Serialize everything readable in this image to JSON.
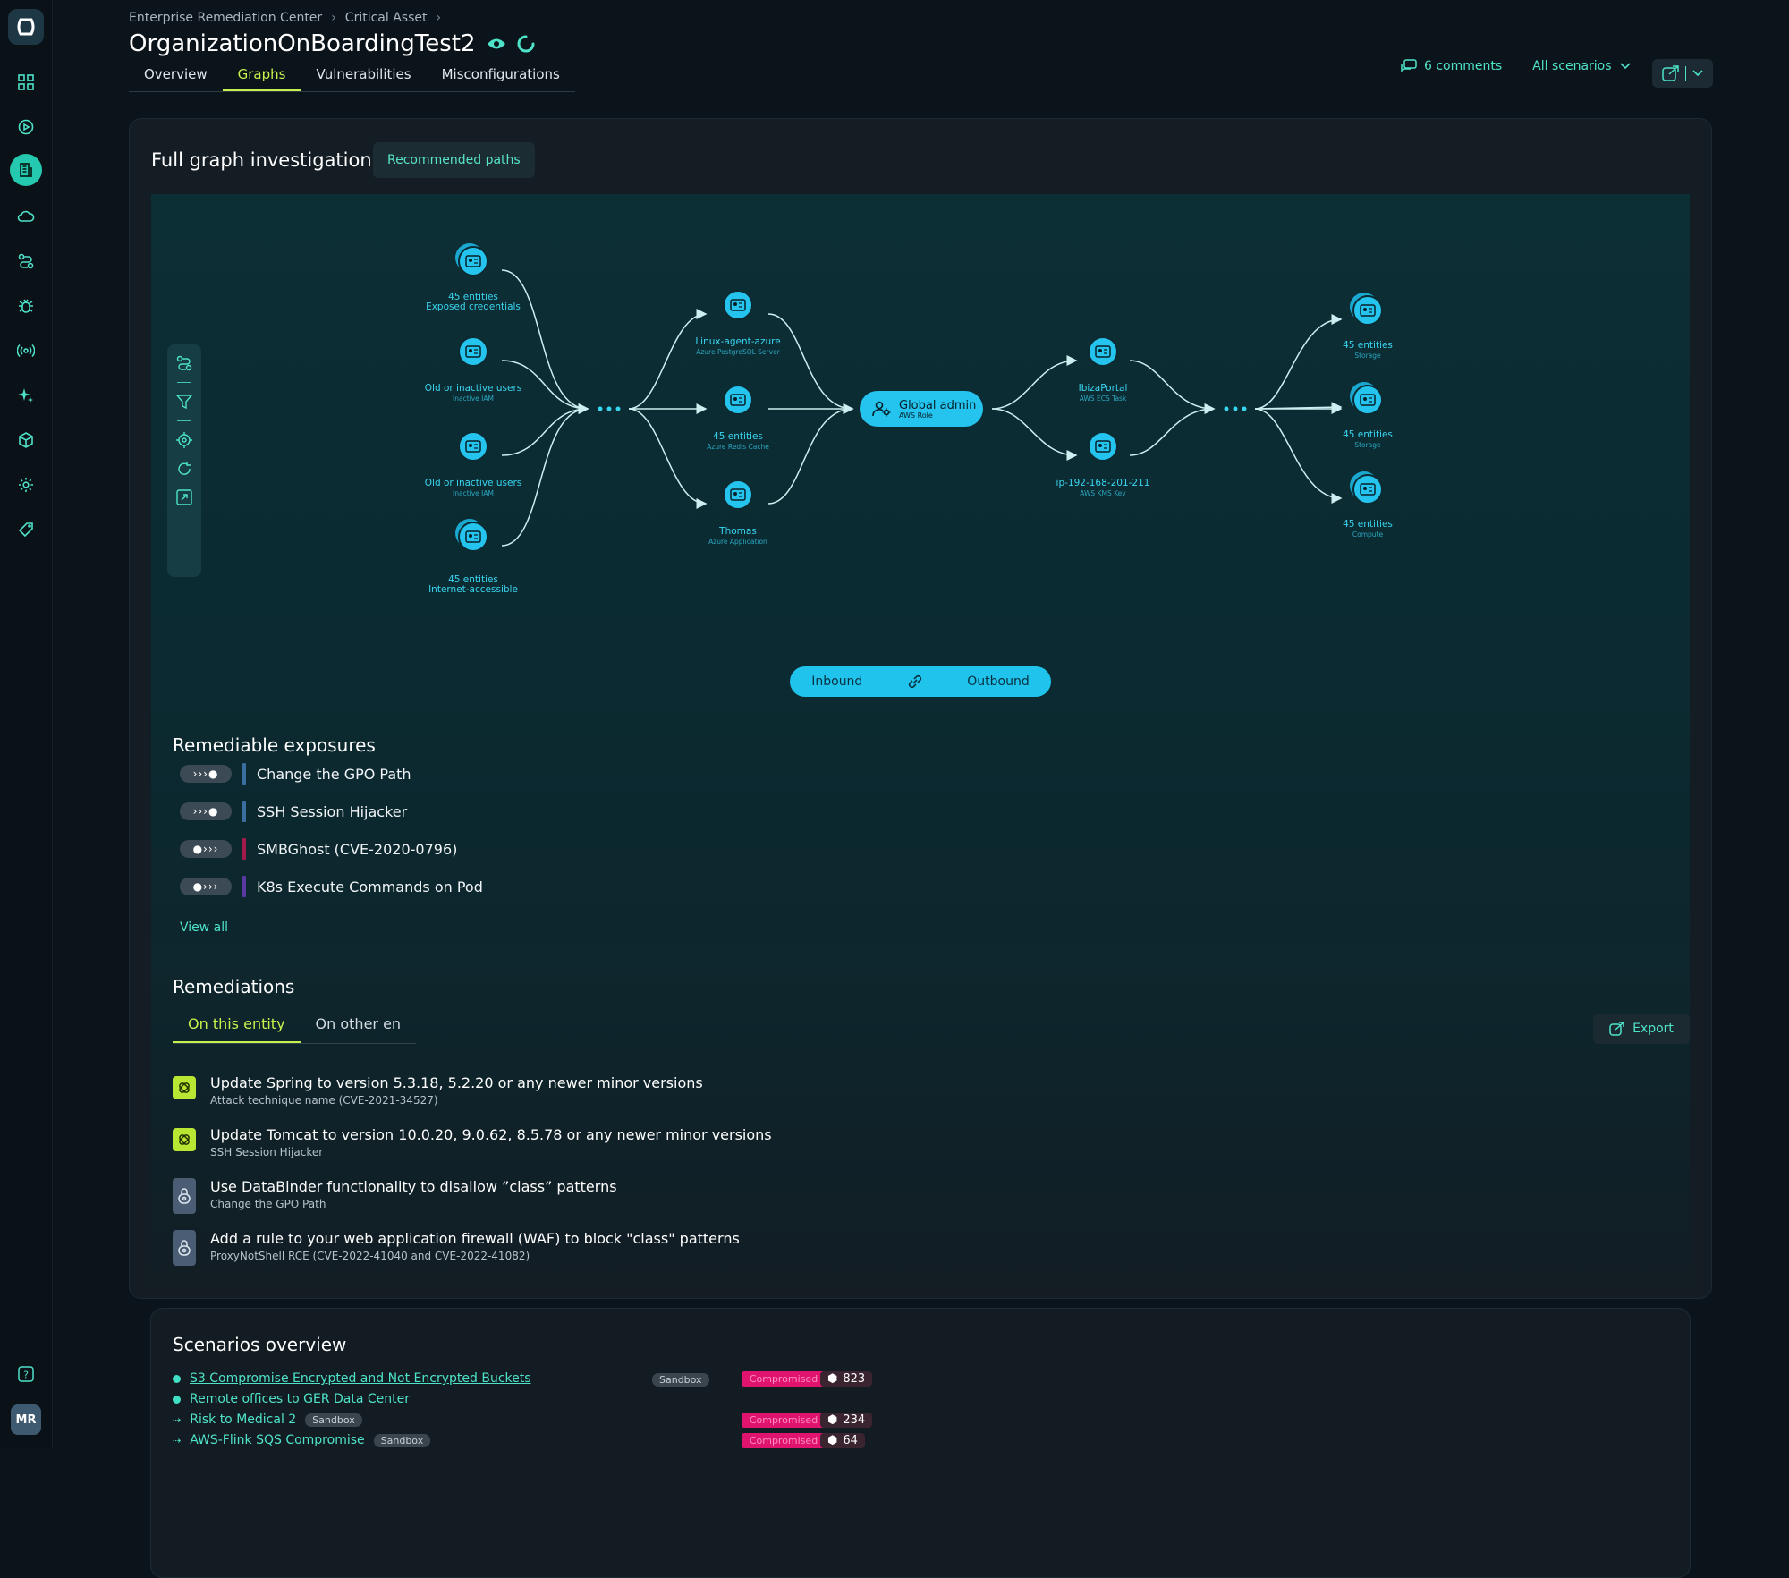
{
  "breadcrumb": [
    "Enterprise Remediation Center",
    "Critical Asset"
  ],
  "page_title": "OrganizationOnBoardingTest2",
  "tabs": [
    {
      "label": "Overview"
    },
    {
      "label": "Graphs",
      "active": true
    },
    {
      "label": "Vulnerabilities"
    },
    {
      "label": "Misconfigurations"
    }
  ],
  "header": {
    "comments": "6 comments",
    "scenarios": "All scenarios"
  },
  "sidebar": {
    "icons": [
      "dashboard-icon",
      "play-icon",
      "building-icon",
      "cloud-icon",
      "route-icon",
      "bug-icon",
      "broadcast-icon",
      "sparkle-icon",
      "cube-icon",
      "gear-icon",
      "tag-icon"
    ],
    "active_index": 2,
    "help": "?",
    "avatar": "MR"
  },
  "graph_panel": {
    "title": "Full graph investigation",
    "recommended_button": "Recommended paths",
    "nodes_left": [
      {
        "main": "45 entities",
        "sub": "Exposed credentials",
        "sub_style": "main"
      },
      {
        "main": "Old or inactive users",
        "sub": "Inactive IAM"
      },
      {
        "main": "Old or inactive users",
        "sub": "Inactive IAM"
      },
      {
        "main": "45 entities",
        "sub": "Internet-accessible",
        "sub_style": "main"
      }
    ],
    "nodes_mid": [
      {
        "main": "Linux-agent-azure",
        "sub": "Azure PostgreSQL Server"
      },
      {
        "main": "45 entities",
        "sub": "Azure Redis Cache"
      },
      {
        "main": "Thomas",
        "sub": "Azure Application"
      }
    ],
    "center": {
      "main": "Global admin",
      "sub": "AWS Role"
    },
    "nodes_after": [
      {
        "main": "IbizaPortal",
        "sub": "AWS ECS Task"
      },
      {
        "main": "ip-192-168-201-211",
        "sub": "AWS KMS Key"
      }
    ],
    "nodes_right": [
      {
        "main": "45 entities",
        "sub": "Storage"
      },
      {
        "main": "45 entities",
        "sub": "Storage"
      },
      {
        "main": "45 entities",
        "sub": "Compute"
      }
    ],
    "direction": {
      "inbound": "Inbound",
      "outbound": "Outbound"
    },
    "colors": {
      "node": "#24c4ee",
      "edge": "#cfeef2",
      "accent": "#c8f04c"
    }
  },
  "exposures": {
    "title": "Remediable exposures",
    "items": [
      {
        "pill": "›››●",
        "label": "Change the GPO Path",
        "color": "#3a6e9e"
      },
      {
        "pill": "›››●",
        "label": "SSH Session Hijacker",
        "color": "#3a6e9e"
      },
      {
        "pill": "●›››",
        "label": "SMBGhost (CVE-2020-0796)",
        "color": "#a01a4c"
      },
      {
        "pill": "●›››",
        "label": "K8s Execute Commands on Pod",
        "color": "#5a3aa0"
      }
    ],
    "view_all": "View all"
  },
  "remediations": {
    "title": "Remediations",
    "tabs": [
      "On this entity",
      "On other en"
    ],
    "export": "Export",
    "items": [
      {
        "title": "Update Spring to version 5.3.18, 5.2.20 or any newer minor versions",
        "sub": "Attack technique name (CVE-2021-34527)",
        "icon": "green"
      },
      {
        "title": "Update Tomcat to version 10.0.20, 9.0.62, 8.5.78 or any newer minor versions",
        "sub": "SSH Session Hijacker",
        "icon": "green"
      },
      {
        "title": "Use DataBinder functionality to disallow ”class” patterns",
        "sub": "Change the GPO Path",
        "icon": "grey"
      },
      {
        "title": "Add a rule to your web application firewall (WAF) to block \"class\" patterns",
        "sub": "ProxyNotShell RCE (CVE-2022-41040 and CVE-2022-41082)",
        "icon": "grey"
      }
    ]
  },
  "scenarios": {
    "title": "Scenarios overview",
    "rows": [
      {
        "name": "S3 Compromise Encrypted and Not Encrypted Buckets",
        "tag": "Sandbox",
        "status": "Compromised",
        "count": "823",
        "marker": "dot",
        "link": true
      },
      {
        "name": "Remote offices to GER Data Center",
        "tag": "",
        "status": "",
        "count": "",
        "marker": "dot"
      },
      {
        "name": "Risk to Medical 2",
        "tag": "Sandbox",
        "status": "Compromised",
        "count": "234",
        "marker": "arrow"
      },
      {
        "name": "AWS-Flink SQS Compromise",
        "tag": "Sandbox",
        "status": "Compromised",
        "count": "64",
        "marker": "arrow"
      }
    ]
  }
}
